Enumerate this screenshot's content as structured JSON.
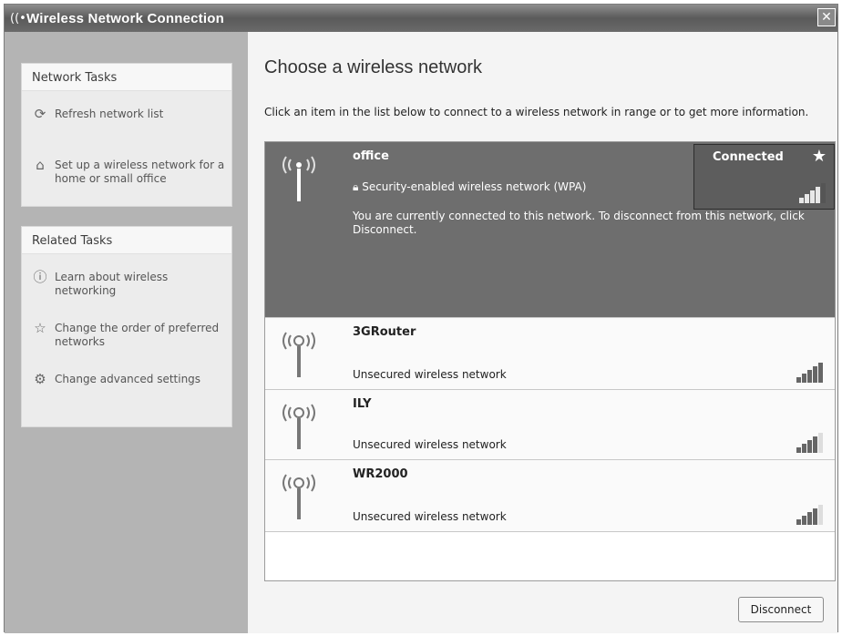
{
  "window": {
    "title": "Wireless Network Connection",
    "close_label": "✕"
  },
  "sidebar": {
    "network_tasks": {
      "header": "Network Tasks",
      "items": [
        {
          "icon": "refresh-icon",
          "label": "Refresh network list"
        },
        {
          "icon": "setup-network-icon",
          "label": "Set up a wireless network for a home or small office"
        }
      ]
    },
    "related_tasks": {
      "header": "Related Tasks",
      "items": [
        {
          "icon": "info-icon",
          "label": "Learn about wireless networking"
        },
        {
          "icon": "star-order-icon",
          "label": "Change the order of preferred networks"
        },
        {
          "icon": "settings-icon",
          "label": "Change advanced settings"
        }
      ]
    }
  },
  "main": {
    "heading": "Choose a wireless network",
    "instructions": "Click an item in the list below to connect to a wireless network in range or to get more information.",
    "networks": [
      {
        "name": "office",
        "security": "Security-enabled wireless network (WPA)",
        "status": "Connected",
        "description": "You are currently connected to this network. To disconnect from this network, click Disconnect.",
        "signal_bars": 4,
        "selected": true
      },
      {
        "name": "3GRouter",
        "security": "Unsecured wireless network",
        "signal_bars": 5,
        "selected": false
      },
      {
        "name": "ILY",
        "security": "Unsecured wireless network",
        "signal_bars": 4,
        "selected": false
      },
      {
        "name": "WR2000",
        "security": "Unsecured wireless network",
        "signal_bars": 4,
        "selected": false
      }
    ],
    "disconnect_label": "Disconnect"
  },
  "colors": {
    "selected_row": "#6e6e6e",
    "sidebar_bg": "#b4b4b4",
    "titlebar": "#6a6a6a"
  }
}
